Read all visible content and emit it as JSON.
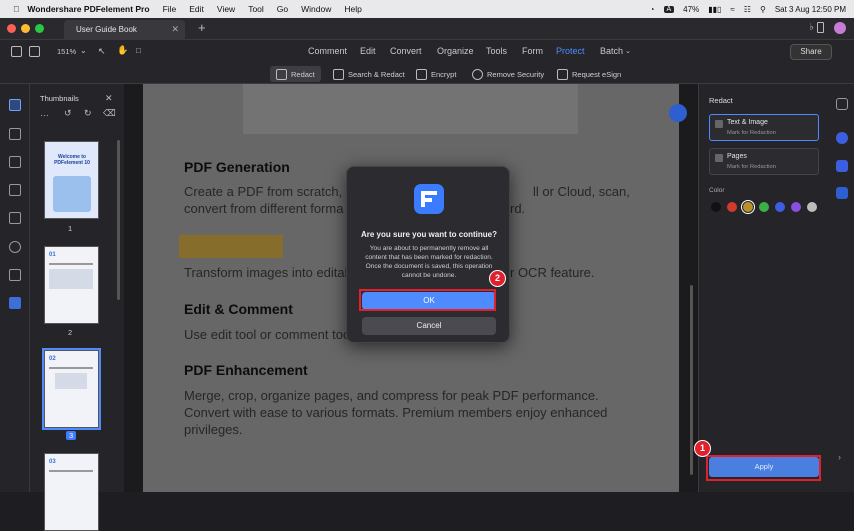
{
  "menubar": {
    "app": "Wondershare PDFelement Pro",
    "items": [
      "File",
      "Edit",
      "View",
      "Tool",
      "Go",
      "Window",
      "Help"
    ],
    "battery": "47%",
    "input": "A",
    "datetime": "Sat 3 Aug  12:50 PM"
  },
  "tab": {
    "title": "User Guide Book"
  },
  "toolbar": {
    "zoom": "151%",
    "nav": [
      "Comment",
      "Edit",
      "Convert",
      "Organize",
      "Tools",
      "Form",
      "Protect",
      "Batch"
    ],
    "active": "Protect",
    "share": "Share"
  },
  "protect_tools": [
    "Redact",
    "Search & Redact",
    "Encrypt",
    "Remove Security",
    "Request eSign"
  ],
  "thumbnails": {
    "title": "Thumbnails",
    "pages": [
      "1",
      "2",
      "3"
    ],
    "selected": "3",
    "p1_title": "Welcome to PDFelement 10",
    "p2_code": "01",
    "p3_code": "02",
    "p4_code": "03"
  },
  "document": {
    "h_generation": "PDF Generation",
    "p_generation_1": "Create a PDF from scratch, u",
    "p_generation_1b": "ll or Cloud, scan,",
    "p_generation_2": "convert from different forma",
    "p_generation_2b": "rd.",
    "p_ocr": "Transform images into editab",
    "p_ocr_b": "r OCR feature.",
    "h_edit": "Edit & Comment",
    "p_edit": "Use edit tool or comment too",
    "h_enh": "PDF Enhancement",
    "p_enh_1": "Merge, crop, organize pages, and compress for peak PDF performance.",
    "p_enh_2": "Convert with ease to various formats. Premium members enjoy enhanced",
    "p_enh_3": "privileges."
  },
  "dialog": {
    "title": "Are you sure you want to continue?",
    "message": "You are about to permanently remove all content that has been marked for redaction. Once the document is saved, this operation cannot be undone.",
    "ok": "OK",
    "cancel": "Cancel"
  },
  "callouts": {
    "one": "1",
    "two": "2"
  },
  "redact_panel": {
    "title": "Redact",
    "options": [
      {
        "label": "Text & Image",
        "sub": "Mark for Redaction"
      },
      {
        "label": "Pages",
        "sub": "Mark for Redaction"
      }
    ],
    "color_label": "Color",
    "colors": [
      "#111111",
      "#d23a2c",
      "#b8902c",
      "#3cb044",
      "#3b5fe0",
      "#8a4fe0",
      "#bdbdbd"
    ],
    "apply": "Apply"
  }
}
